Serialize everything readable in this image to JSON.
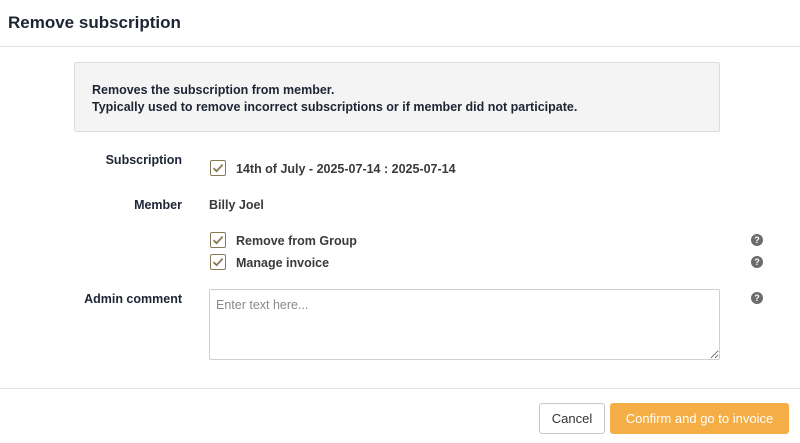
{
  "dialog": {
    "title": "Remove subscription"
  },
  "info": {
    "line1": "Removes the subscription from member.",
    "line2": "Typically used to remove incorrect subscriptions or if member did not participate."
  },
  "subscription": {
    "label": "Subscription",
    "value": "14th of July - 2025-07-14 : 2025-07-14",
    "checked": true
  },
  "member": {
    "label": "Member",
    "value": "Billy Joel"
  },
  "options": {
    "remove_from_group": {
      "label": "Remove from Group",
      "checked": true
    },
    "manage_invoice": {
      "label": "Manage invoice",
      "checked": true
    }
  },
  "admin_comment": {
    "label": "Admin comment",
    "placeholder": "Enter text here..."
  },
  "help_glyph": "?",
  "buttons": {
    "cancel": "Cancel",
    "confirm": "Confirm and go to invoice"
  },
  "colors": {
    "accent": "#f5ae45",
    "checkbox_border": "#8a7a55"
  },
  "icons": {
    "checkbox": "check-icon",
    "help": "question-circle-icon"
  }
}
